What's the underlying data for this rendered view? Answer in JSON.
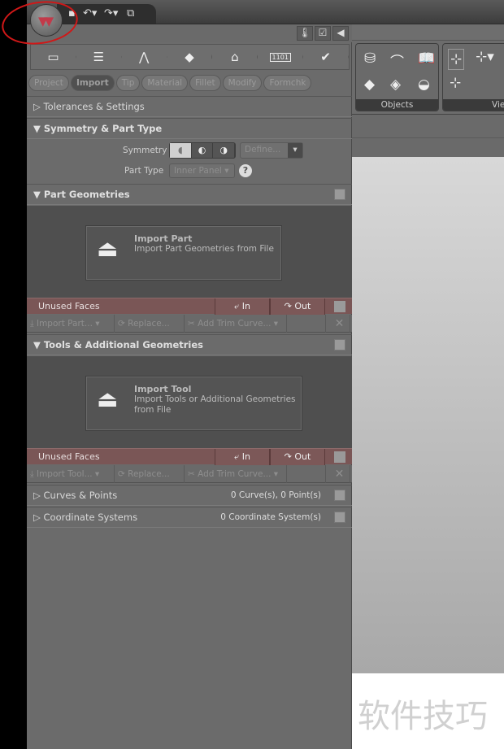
{
  "quick_access": {
    "icons": [
      "save-icon",
      "undo-icon",
      "redo-icon",
      "window-icon"
    ]
  },
  "panel_header": {
    "icons": [
      "thermometer-icon",
      "checklist-icon",
      "collapse-left-icon"
    ]
  },
  "steps": [
    "import-step-icon",
    "structure-step-icon",
    "tip-step-icon",
    "material-step-icon",
    "fillet-step-icon",
    "code-1101-icon",
    "formcheck-step-icon"
  ],
  "step_code": "1101",
  "tabs": [
    {
      "label": "Project"
    },
    {
      "label": "Import",
      "active": true
    },
    {
      "label": "Tip"
    },
    {
      "label": "Material"
    },
    {
      "label": "Fillet"
    },
    {
      "label": "Modify"
    },
    {
      "label": "Formchk"
    }
  ],
  "sections": {
    "tolerances": "Tolerances & Settings",
    "symmetry": {
      "title": "Symmetry & Part Type",
      "symmetry_label": "Symmetry",
      "define": "Define...",
      "part_type_label": "Part Type",
      "part_type_value": "Inner Panel",
      "help": "?"
    },
    "part_geometries": {
      "title": "Part Geometries",
      "card_title": "Import Part",
      "card_sub": "Import Part Geometries from File"
    },
    "tools": {
      "title": "Tools & Additional Geometries",
      "card_title": "Import Tool",
      "card_sub": "Import Tools or Additional Geometries from File"
    },
    "curves": {
      "title": "Curves & Points",
      "count": "0 Curve(s), 0 Point(s)"
    },
    "coords": {
      "title": "Coordinate Systems",
      "count": "0 Coordinate System(s)"
    }
  },
  "unused": {
    "label": "Unused Faces",
    "in": "In",
    "out": "Out"
  },
  "toolbar1": {
    "import": "Import Part...",
    "replace": "Replace...",
    "trim": "Add Trim Curve..."
  },
  "toolbar2": {
    "import": "Import Tool...",
    "replace": "Replace...",
    "trim": "Add Trim Curve..."
  },
  "ribbon": {
    "objects": "Objects",
    "view": "Vie"
  },
  "watermark": "软件技巧",
  "colors": {
    "unused_bar": "#7a5656",
    "panel": "#6b6b6b",
    "annotation": "#d01818"
  }
}
